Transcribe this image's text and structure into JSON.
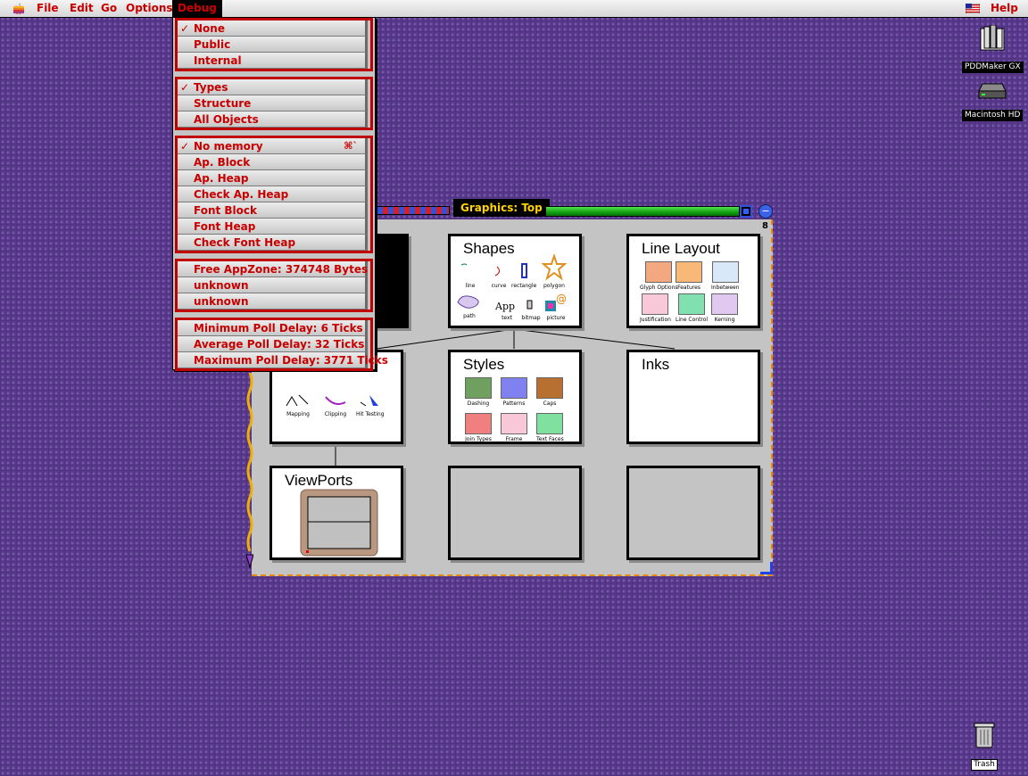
{
  "menubar": {
    "menus": [
      "File",
      "Edit",
      "Go",
      "Options",
      "Debug"
    ],
    "active_menu": "Debug",
    "help": "Help"
  },
  "desktop": {
    "icons": [
      {
        "label": "PDDMaker GX",
        "selected": true
      },
      {
        "label": "Macintosh HD",
        "selected": true
      },
      {
        "label": "Trash",
        "selected": false
      }
    ]
  },
  "debug_menu": {
    "groups": [
      {
        "items": [
          {
            "label": "None",
            "checked": true
          },
          {
            "label": "Public",
            "checked": false
          },
          {
            "label": "Internal",
            "checked": false
          }
        ]
      },
      {
        "items": [
          {
            "label": "Types",
            "checked": true
          },
          {
            "label": "Structure",
            "checked": false
          },
          {
            "label": "All Objects",
            "checked": false
          }
        ]
      },
      {
        "items": [
          {
            "label": "No memory",
            "checked": true,
            "shortcut": "⌘`"
          },
          {
            "label": "Ap. Block",
            "checked": false
          },
          {
            "label": "Ap. Heap",
            "checked": false
          },
          {
            "label": "Check Ap. Heap",
            "checked": false
          },
          {
            "label": "Font Block",
            "checked": false
          },
          {
            "label": "Font Heap",
            "checked": false
          },
          {
            "label": "Check Font Heap",
            "checked": false
          }
        ]
      },
      {
        "items": [
          {
            "label": "Free AppZone: 374748 Bytes",
            "checked": false
          },
          {
            "label": "unknown",
            "checked": false
          },
          {
            "label": "unknown",
            "checked": false
          }
        ]
      },
      {
        "items": [
          {
            "label": "Minimum Poll Delay: 6 Ticks",
            "checked": false
          },
          {
            "label": "Average Poll Delay: 32 Ticks",
            "checked": false
          },
          {
            "label": "Maximum Poll Delay: 3771 Ticks",
            "checked": false
          }
        ]
      }
    ]
  },
  "graphics_window": {
    "title": "Graphics: Top",
    "tile_count": "8",
    "tiles": {
      "shapes": {
        "title": "Shapes",
        "thumbs": [
          "line",
          "curve",
          "rectangle",
          "polygon",
          "path",
          "text",
          "bitmap",
          "picture"
        ]
      },
      "line_layout": {
        "title": "Line Layout",
        "thumbs": [
          "Glyph Options",
          "Features",
          "Inbetween",
          "Justification",
          "Line Control",
          "Kerning"
        ]
      },
      "transforms": {
        "thumbs": [
          "Mapping",
          "Clipping",
          "Hit Testing"
        ]
      },
      "styles": {
        "title": "Styles",
        "thumbs": [
          "Dashing",
          "Patterns",
          "Caps",
          "Join Types",
          "Frame",
          "Text Faces"
        ]
      },
      "inks": {
        "title": "Inks"
      },
      "viewports": {
        "title": "ViewPorts"
      }
    },
    "colors": {
      "title_text": "#ffd200",
      "menu_text": "#c80000",
      "desktop": "#5a3a8c"
    }
  }
}
